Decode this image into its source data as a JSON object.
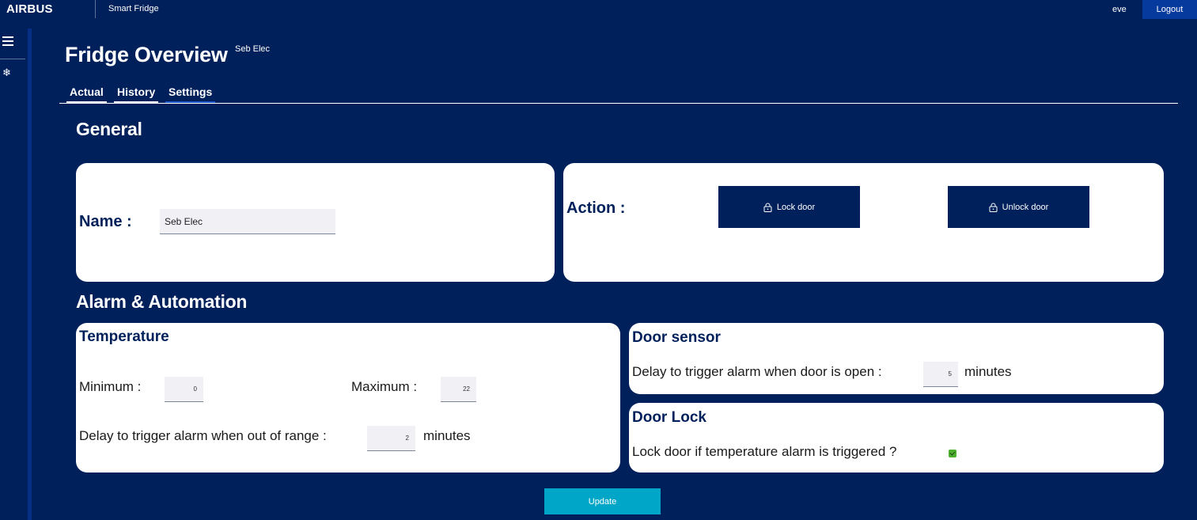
{
  "topbar": {
    "brand": "AIRBUS",
    "app_name": "Smart Fridge",
    "user": "eve",
    "logout_label": "Logout"
  },
  "sidebar": {
    "icons": [
      "menu-icon",
      "snowflake-icon"
    ]
  },
  "header": {
    "title": "Fridge Overview",
    "subtitle": "Seb Elec"
  },
  "tabs": [
    {
      "label": "Actual",
      "selected": false
    },
    {
      "label": "History",
      "selected": false
    },
    {
      "label": "Settings",
      "selected": true
    }
  ],
  "general": {
    "title": "General",
    "name_label": "Name :",
    "name_value": "Seb Elec",
    "action_label": "Action :",
    "lock_label": "Lock door",
    "unlock_label": "Unlock door"
  },
  "alarm": {
    "title": "Alarm & Automation",
    "temperature": {
      "title": "Temperature",
      "min_label": "Minimum :",
      "min_value": "0",
      "max_label": "Maximum :",
      "max_value": "22",
      "delay_label": "Delay to trigger alarm when out of range :",
      "delay_value": "2",
      "delay_unit": "minutes"
    },
    "door_sensor": {
      "title": "Door sensor",
      "delay_label": "Delay to trigger alarm when door is open :",
      "delay_value": "5",
      "delay_unit": "minutes"
    },
    "door_lock": {
      "title": "Door Lock",
      "question": "Lock door if temperature alarm is triggered ?",
      "checked": true
    }
  },
  "update_label": "Update",
  "colors": {
    "background": "#00205b",
    "accent": "#063a9c",
    "update": "#00a6c7",
    "check": "#4caf2e"
  }
}
